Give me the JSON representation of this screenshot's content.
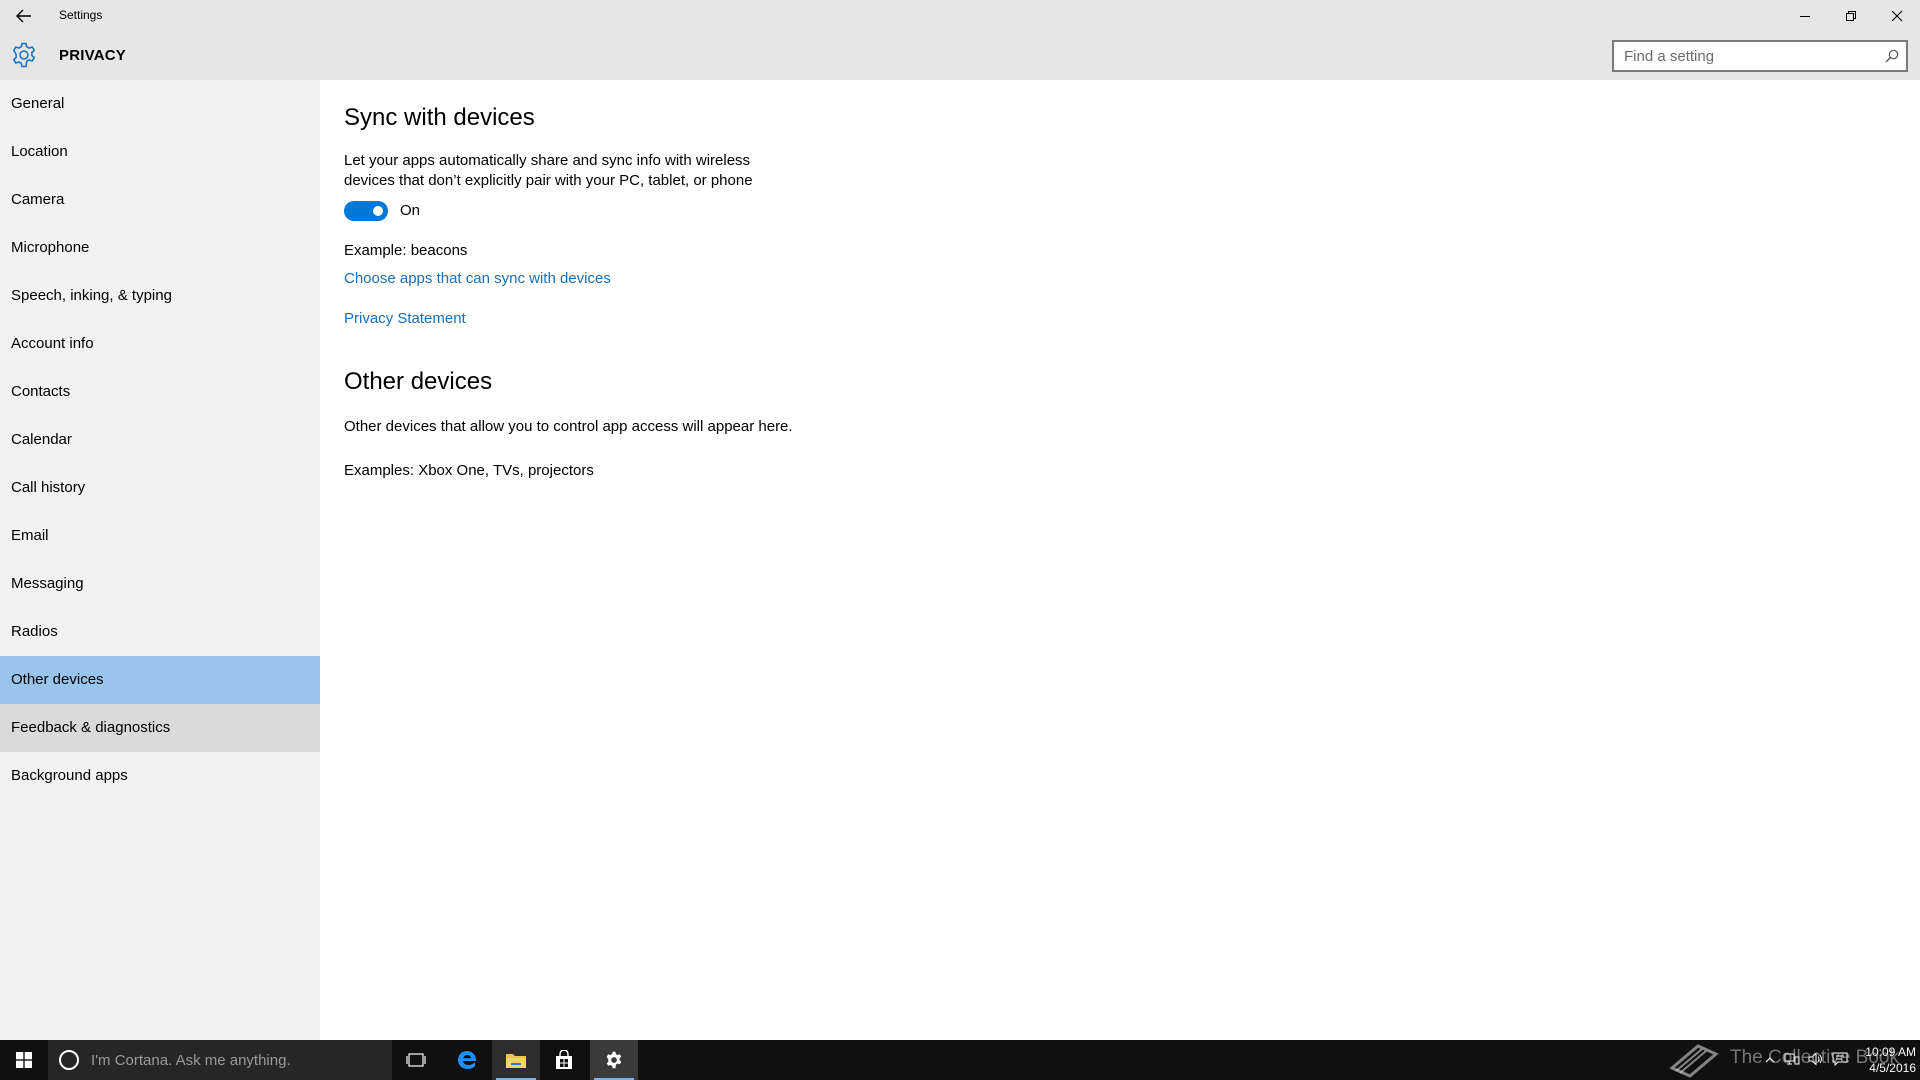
{
  "window": {
    "title": "Settings",
    "back_icon": "arrow-left-icon",
    "controls": {
      "minimize_glyph": "—",
      "restore_glyph": "❐",
      "close_glyph": "✕"
    }
  },
  "header": {
    "icon": "gear-icon",
    "title": "PRIVACY",
    "search_placeholder": "Find a setting"
  },
  "sidebar": {
    "selected": "Other devices",
    "hovered": "Feedback & diagnostics",
    "items": [
      {
        "label": "General"
      },
      {
        "label": "Location"
      },
      {
        "label": "Camera"
      },
      {
        "label": "Microphone"
      },
      {
        "label": "Speech, inking, & typing"
      },
      {
        "label": "Account info"
      },
      {
        "label": "Contacts"
      },
      {
        "label": "Calendar"
      },
      {
        "label": "Call history"
      },
      {
        "label": "Email"
      },
      {
        "label": "Messaging"
      },
      {
        "label": "Radios"
      },
      {
        "label": "Other devices"
      },
      {
        "label": "Feedback & diagnostics"
      },
      {
        "label": "Background apps"
      }
    ]
  },
  "main": {
    "sync_heading": "Sync with devices",
    "sync_description": "Let your apps automatically share and sync info with wireless devices that don’t explicitly pair with your PC, tablet, or phone",
    "toggle_state": "On",
    "example_text": "Example: beacons",
    "choose_apps_link": "Choose apps that can sync with devices",
    "privacy_link": "Privacy Statement",
    "other_heading": "Other devices",
    "other_description": "Other devices that allow you to control app access will appear here.",
    "other_examples": "Examples: Xbox One, TVs, projectors"
  },
  "taskbar": {
    "cortana_placeholder": "I'm Cortana. Ask me anything.",
    "apps": [
      "task-view-icon",
      "edge-icon",
      "file-explorer-icon",
      "store-icon",
      "settings-icon"
    ],
    "clock_time": "10:09 AM",
    "clock_date": "4/5/2016",
    "watermark": "The Collective Book"
  },
  "colors": {
    "accent": "#0078d7",
    "link": "#1a6fb5",
    "selected_nav": "#99c4eb",
    "hover_nav": "#dadada",
    "chrome": "#e6e6e6"
  }
}
